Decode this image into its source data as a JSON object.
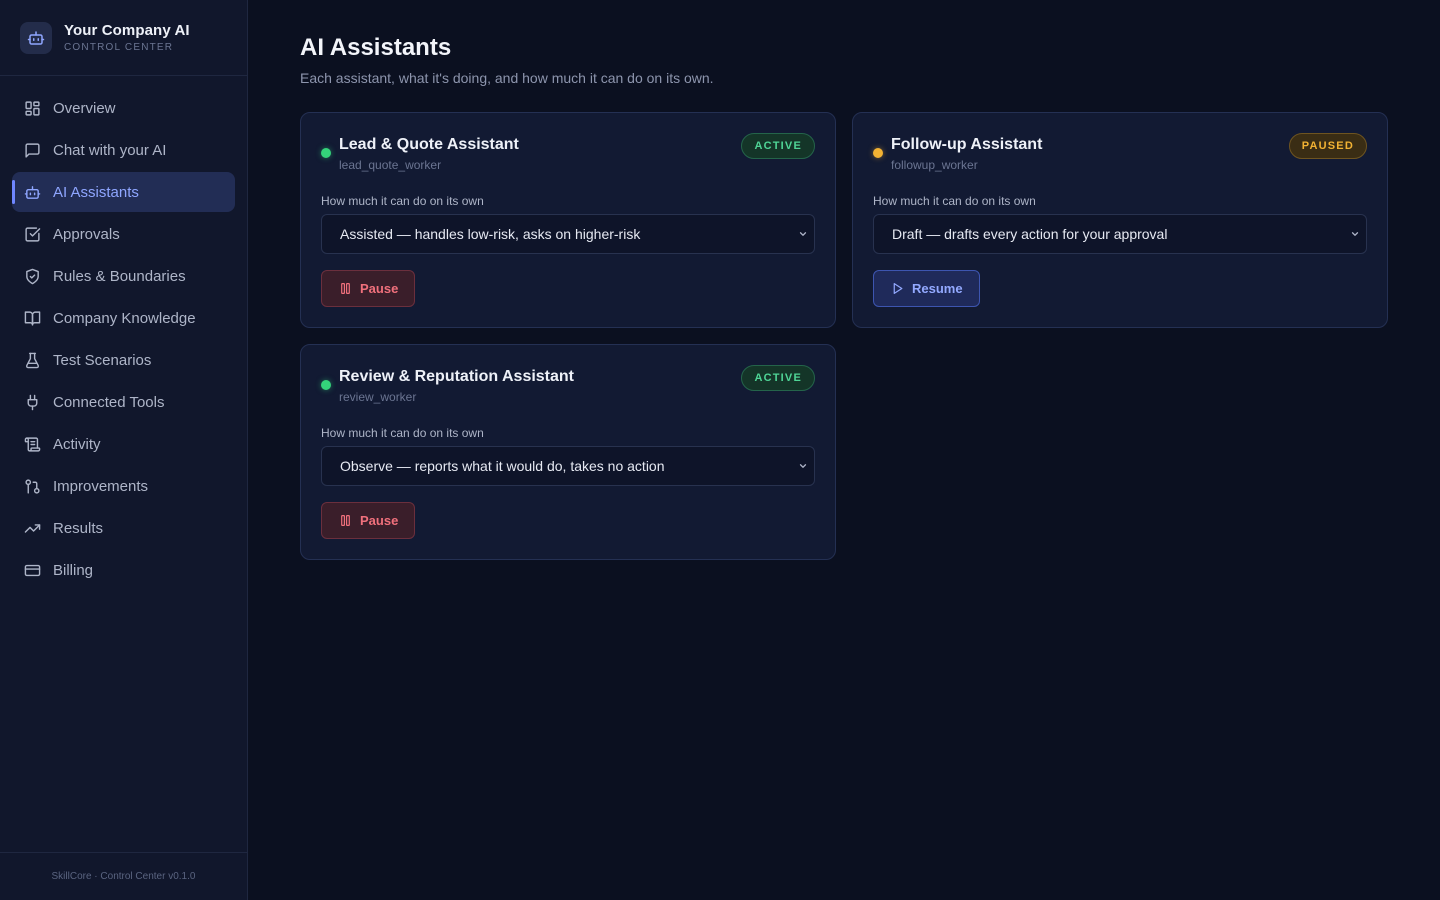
{
  "brand": {
    "name": "Your Company AI",
    "subtitle": "CONTROL CENTER"
  },
  "sidebar": {
    "items": [
      {
        "label": "Overview",
        "icon": "grid-icon"
      },
      {
        "label": "Chat with your AI",
        "icon": "chat-icon"
      },
      {
        "label": "AI Assistants",
        "icon": "robot-icon",
        "active": true
      },
      {
        "label": "Approvals",
        "icon": "check-square-icon"
      },
      {
        "label": "Rules & Boundaries",
        "icon": "shield-icon"
      },
      {
        "label": "Company Knowledge",
        "icon": "book-icon"
      },
      {
        "label": "Test Scenarios",
        "icon": "flask-icon"
      },
      {
        "label": "Connected Tools",
        "icon": "plug-icon"
      },
      {
        "label": "Activity",
        "icon": "scroll-icon"
      },
      {
        "label": "Improvements",
        "icon": "git-icon"
      },
      {
        "label": "Results",
        "icon": "trend-icon"
      },
      {
        "label": "Billing",
        "icon": "card-icon"
      }
    ],
    "footer": "SkillCore · Control Center v0.1.0"
  },
  "page": {
    "title": "AI Assistants",
    "subtitle": "Each assistant, what it's doing, and how much it can do on its own."
  },
  "assistants": [
    {
      "name": "Lead & Quote Assistant",
      "id": "lead_quote_worker",
      "status": "ACTIVE",
      "autonomy_label": "How much it can do on its own",
      "autonomy_value": "Assisted — handles low-risk, asks on higher-risk",
      "action": "Pause"
    },
    {
      "name": "Follow-up Assistant",
      "id": "followup_worker",
      "status": "PAUSED",
      "autonomy_label": "How much it can do on its own",
      "autonomy_value": "Draft — drafts every action for your approval",
      "action": "Resume"
    },
    {
      "name": "Review & Reputation Assistant",
      "id": "review_worker",
      "status": "ACTIVE",
      "autonomy_label": "How much it can do on its own",
      "autonomy_value": "Observe — reports what it would do, takes no action",
      "action": "Pause"
    }
  ],
  "colors": {
    "accent": "#6f86ff",
    "active": "#34d27a",
    "paused": "#f2b233",
    "danger": "#f0707c",
    "background": "#0b1020"
  }
}
